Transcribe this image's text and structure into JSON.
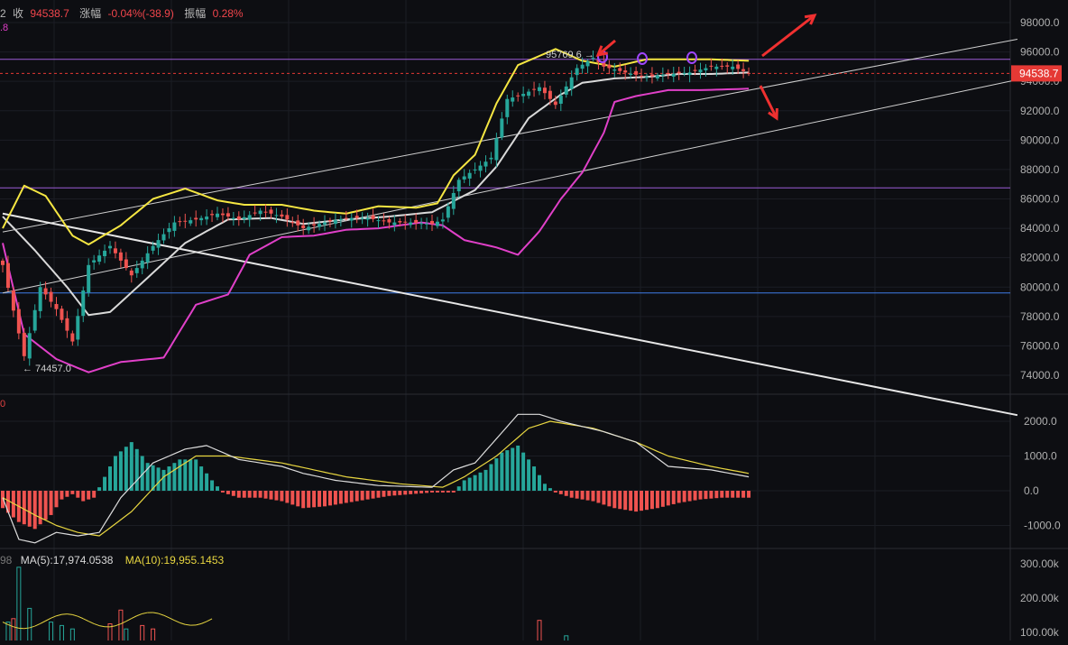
{
  "header": {
    "prefix": "2",
    "close_label": "收",
    "close_value": "94538.7",
    "change_label": "涨幅",
    "change_value": "-0.04%(-38.9)",
    "amplitude_label": "振幅",
    "amplitude_value": "0.28%"
  },
  "sub_indicator_label": ".8",
  "macd_label": "0",
  "volume_header": {
    "prefix": "98",
    "ma5": "MA(5):17,974.0538",
    "ma10": "MA(10):19,955.1453"
  },
  "colors": {
    "background": "#0d0e12",
    "up": "#26a69a",
    "down": "#ef5350",
    "upper_band": "#f5e642",
    "lower_band": "#e040c8",
    "mid_band": "#d9d9d9",
    "level_line": "#9c5bd6",
    "support_line": "#3f7ce8",
    "arrow": "#f03030",
    "price_tag": "#e53935"
  },
  "chart_data": [
    {
      "type": "candlestick",
      "title": "",
      "price_axis": {
        "ticks": [
          "98000.0",
          "96000.0",
          "94000.0",
          "92000.0",
          "90000.0",
          "88000.0",
          "86000.0",
          "84000.0",
          "82000.0",
          "80000.0",
          "78000.0",
          "76000.0",
          "74000.0"
        ],
        "range": [
          73000,
          99000
        ]
      },
      "last_price": "94538.7",
      "high_label": "95769.6",
      "low_label": "74457.0",
      "horizontal_levels": [
        {
          "value": 95500,
          "color": "purple"
        },
        {
          "value": 86750,
          "color": "purple"
        },
        {
          "value": 79600,
          "color": "blue"
        }
      ],
      "trend_lines": [
        {
          "from": {
            "i": 0,
            "v": 83750
          },
          "to": {
            "i": 142,
            "v": 93600
          }
        },
        {
          "from": {
            "i": 0,
            "v": 79600
          },
          "to": {
            "i": 142,
            "v": 90500
          }
        },
        {
          "from": {
            "i": 0,
            "v": 85000
          },
          "to": {
            "i": 142,
            "v": 74700
          }
        }
      ],
      "bollinger_upper_anchors": [
        [
          0,
          84000
        ],
        [
          4,
          86900
        ],
        [
          8,
          86200
        ],
        [
          13,
          83500
        ],
        [
          16,
          82900
        ],
        [
          22,
          84200
        ],
        [
          28,
          86000
        ],
        [
          34,
          86700
        ],
        [
          40,
          85900
        ],
        [
          45,
          85600
        ],
        [
          52,
          85600
        ],
        [
          58,
          85200
        ],
        [
          64,
          85000
        ],
        [
          70,
          85500
        ],
        [
          77,
          85400
        ],
        [
          81,
          85700
        ],
        [
          84,
          87600
        ],
        [
          88,
          89000
        ],
        [
          92,
          92500
        ],
        [
          96,
          95100
        ],
        [
          103,
          96200
        ],
        [
          108,
          95400
        ],
        [
          114,
          95000
        ],
        [
          120,
          95500
        ],
        [
          126,
          95500
        ],
        [
          132,
          95500
        ],
        [
          139,
          95400
        ]
      ],
      "bollinger_mid_anchors": [
        [
          0,
          84800
        ],
        [
          6,
          82500
        ],
        [
          12,
          80000
        ],
        [
          16,
          78100
        ],
        [
          20,
          78300
        ],
        [
          26,
          80300
        ],
        [
          34,
          83000
        ],
        [
          42,
          84600
        ],
        [
          50,
          84700
        ],
        [
          56,
          84300
        ],
        [
          64,
          84600
        ],
        [
          72,
          84800
        ],
        [
          80,
          85100
        ],
        [
          88,
          86600
        ],
        [
          92,
          88200
        ],
        [
          98,
          91500
        ],
        [
          104,
          93100
        ],
        [
          108,
          93900
        ],
        [
          114,
          94200
        ],
        [
          120,
          94300
        ],
        [
          126,
          94500
        ],
        [
          132,
          94500
        ],
        [
          139,
          94600
        ]
      ],
      "bollinger_lower_anchors": [
        [
          0,
          83000
        ],
        [
          4,
          76800
        ],
        [
          10,
          75100
        ],
        [
          16,
          74200
        ],
        [
          22,
          74900
        ],
        [
          30,
          75200
        ],
        [
          36,
          78800
        ],
        [
          42,
          79500
        ],
        [
          46,
          82200
        ],
        [
          52,
          83400
        ],
        [
          58,
          83500
        ],
        [
          64,
          83900
        ],
        [
          70,
          84000
        ],
        [
          78,
          84400
        ],
        [
          82,
          84200
        ],
        [
          86,
          83200
        ],
        [
          92,
          82700
        ],
        [
          96,
          82200
        ],
        [
          100,
          83800
        ],
        [
          104,
          86000
        ],
        [
          108,
          87800
        ],
        [
          112,
          90500
        ],
        [
          114,
          92600
        ],
        [
          118,
          93000
        ],
        [
          124,
          93400
        ],
        [
          130,
          93400
        ],
        [
          139,
          93500
        ]
      ],
      "candle_anchors": [
        [
          0,
          81500
        ],
        [
          4,
          75300
        ],
        [
          7,
          80000
        ],
        [
          10,
          78500
        ],
        [
          13,
          76300
        ],
        [
          16,
          81500
        ],
        [
          20,
          82800
        ],
        [
          24,
          80800
        ],
        [
          28,
          82800
        ],
        [
          32,
          84400
        ],
        [
          36,
          84600
        ],
        [
          40,
          85000
        ],
        [
          44,
          84600
        ],
        [
          48,
          85200
        ],
        [
          52,
          84800
        ],
        [
          56,
          84000
        ],
        [
          60,
          84400
        ],
        [
          64,
          84700
        ],
        [
          68,
          84700
        ],
        [
          72,
          84400
        ],
        [
          76,
          84400
        ],
        [
          80,
          84300
        ],
        [
          82,
          84600
        ],
        [
          85,
          87300
        ],
        [
          88,
          88000
        ],
        [
          91,
          88800
        ],
        [
          94,
          92800
        ],
        [
          96,
          93000
        ],
        [
          100,
          93600
        ],
        [
          103,
          92400
        ],
        [
          107,
          94900
        ],
        [
          110,
          95600
        ],
        [
          112,
          95000
        ],
        [
          116,
          94600
        ],
        [
          120,
          94300
        ],
        [
          124,
          94500
        ],
        [
          128,
          94600
        ],
        [
          132,
          95000
        ],
        [
          136,
          95000
        ],
        [
          139,
          94540
        ]
      ]
    },
    {
      "type": "bar",
      "title": "MACD",
      "axis_ticks": [
        "2000.0",
        "1000.0",
        "0.0",
        "-1000.0"
      ],
      "range": [
        -1700,
        2400
      ],
      "dif_anchors": [
        [
          0,
          -200
        ],
        [
          3,
          -1400
        ],
        [
          6,
          -1500
        ],
        [
          10,
          -1200
        ],
        [
          14,
          -1300
        ],
        [
          18,
          -1200
        ],
        [
          22,
          -200
        ],
        [
          28,
          800
        ],
        [
          34,
          1200
        ],
        [
          38,
          1300
        ],
        [
          44,
          900
        ],
        [
          52,
          700
        ],
        [
          56,
          500
        ],
        [
          62,
          300
        ],
        [
          70,
          150
        ],
        [
          80,
          100
        ],
        [
          84,
          600
        ],
        [
          88,
          800
        ],
        [
          92,
          1500
        ],
        [
          96,
          2200
        ],
        [
          100,
          2200
        ],
        [
          104,
          2000
        ],
        [
          112,
          1700
        ],
        [
          118,
          1400
        ],
        [
          124,
          700
        ],
        [
          132,
          600
        ],
        [
          139,
          400
        ]
      ],
      "dea_anchors": [
        [
          0,
          -200
        ],
        [
          6,
          -700
        ],
        [
          10,
          -1000
        ],
        [
          14,
          -1200
        ],
        [
          18,
          -1300
        ],
        [
          24,
          -600
        ],
        [
          30,
          400
        ],
        [
          36,
          1000
        ],
        [
          42,
          1000
        ],
        [
          52,
          800
        ],
        [
          58,
          600
        ],
        [
          64,
          400
        ],
        [
          74,
          200
        ],
        [
          82,
          100
        ],
        [
          86,
          400
        ],
        [
          92,
          1000
        ],
        [
          98,
          1800
        ],
        [
          102,
          2000
        ],
        [
          110,
          1800
        ],
        [
          118,
          1400
        ],
        [
          124,
          1000
        ],
        [
          132,
          700
        ],
        [
          139,
          500
        ]
      ],
      "hist_anchors": [
        [
          0,
          -500
        ],
        [
          3,
          -900
        ],
        [
          6,
          -1100
        ],
        [
          9,
          -700
        ],
        [
          11,
          -250
        ],
        [
          13,
          -100
        ],
        [
          15,
          -300
        ],
        [
          17,
          -200
        ],
        [
          19,
          400
        ],
        [
          21,
          1000
        ],
        [
          24,
          1400
        ],
        [
          27,
          800
        ],
        [
          30,
          600
        ],
        [
          33,
          900
        ],
        [
          36,
          900
        ],
        [
          39,
          300
        ],
        [
          41,
          -50
        ],
        [
          44,
          -200
        ],
        [
          48,
          -200
        ],
        [
          52,
          -300
        ],
        [
          56,
          -500
        ],
        [
          60,
          -450
        ],
        [
          64,
          -350
        ],
        [
          68,
          -250
        ],
        [
          72,
          -150
        ],
        [
          76,
          -100
        ],
        [
          80,
          -50
        ],
        [
          84,
          -50
        ],
        [
          86,
          300
        ],
        [
          90,
          600
        ],
        [
          93,
          1100
        ],
        [
          96,
          1300
        ],
        [
          99,
          700
        ],
        [
          101,
          200
        ],
        [
          103,
          -50
        ],
        [
          106,
          -200
        ],
        [
          110,
          -300
        ],
        [
          114,
          -500
        ],
        [
          118,
          -600
        ],
        [
          122,
          -500
        ],
        [
          126,
          -350
        ],
        [
          130,
          -250
        ],
        [
          134,
          -200
        ],
        [
          139,
          -200
        ]
      ]
    },
    {
      "type": "bar",
      "title": "Volume",
      "axis_ticks": [
        "300.00k",
        "200.00k",
        "100.00k"
      ],
      "range": [
        60000,
        340000
      ],
      "spikes": [
        [
          1,
          130000
        ],
        [
          2,
          140000
        ],
        [
          3,
          290000
        ],
        [
          5,
          170000
        ],
        [
          9,
          130000
        ],
        [
          11,
          120000
        ],
        [
          13,
          110000
        ],
        [
          20,
          125000
        ],
        [
          22,
          165000
        ],
        [
          23,
          110000
        ],
        [
          26,
          120000
        ],
        [
          28,
          110000
        ],
        [
          100,
          135000
        ],
        [
          105,
          90000
        ]
      ]
    }
  ]
}
